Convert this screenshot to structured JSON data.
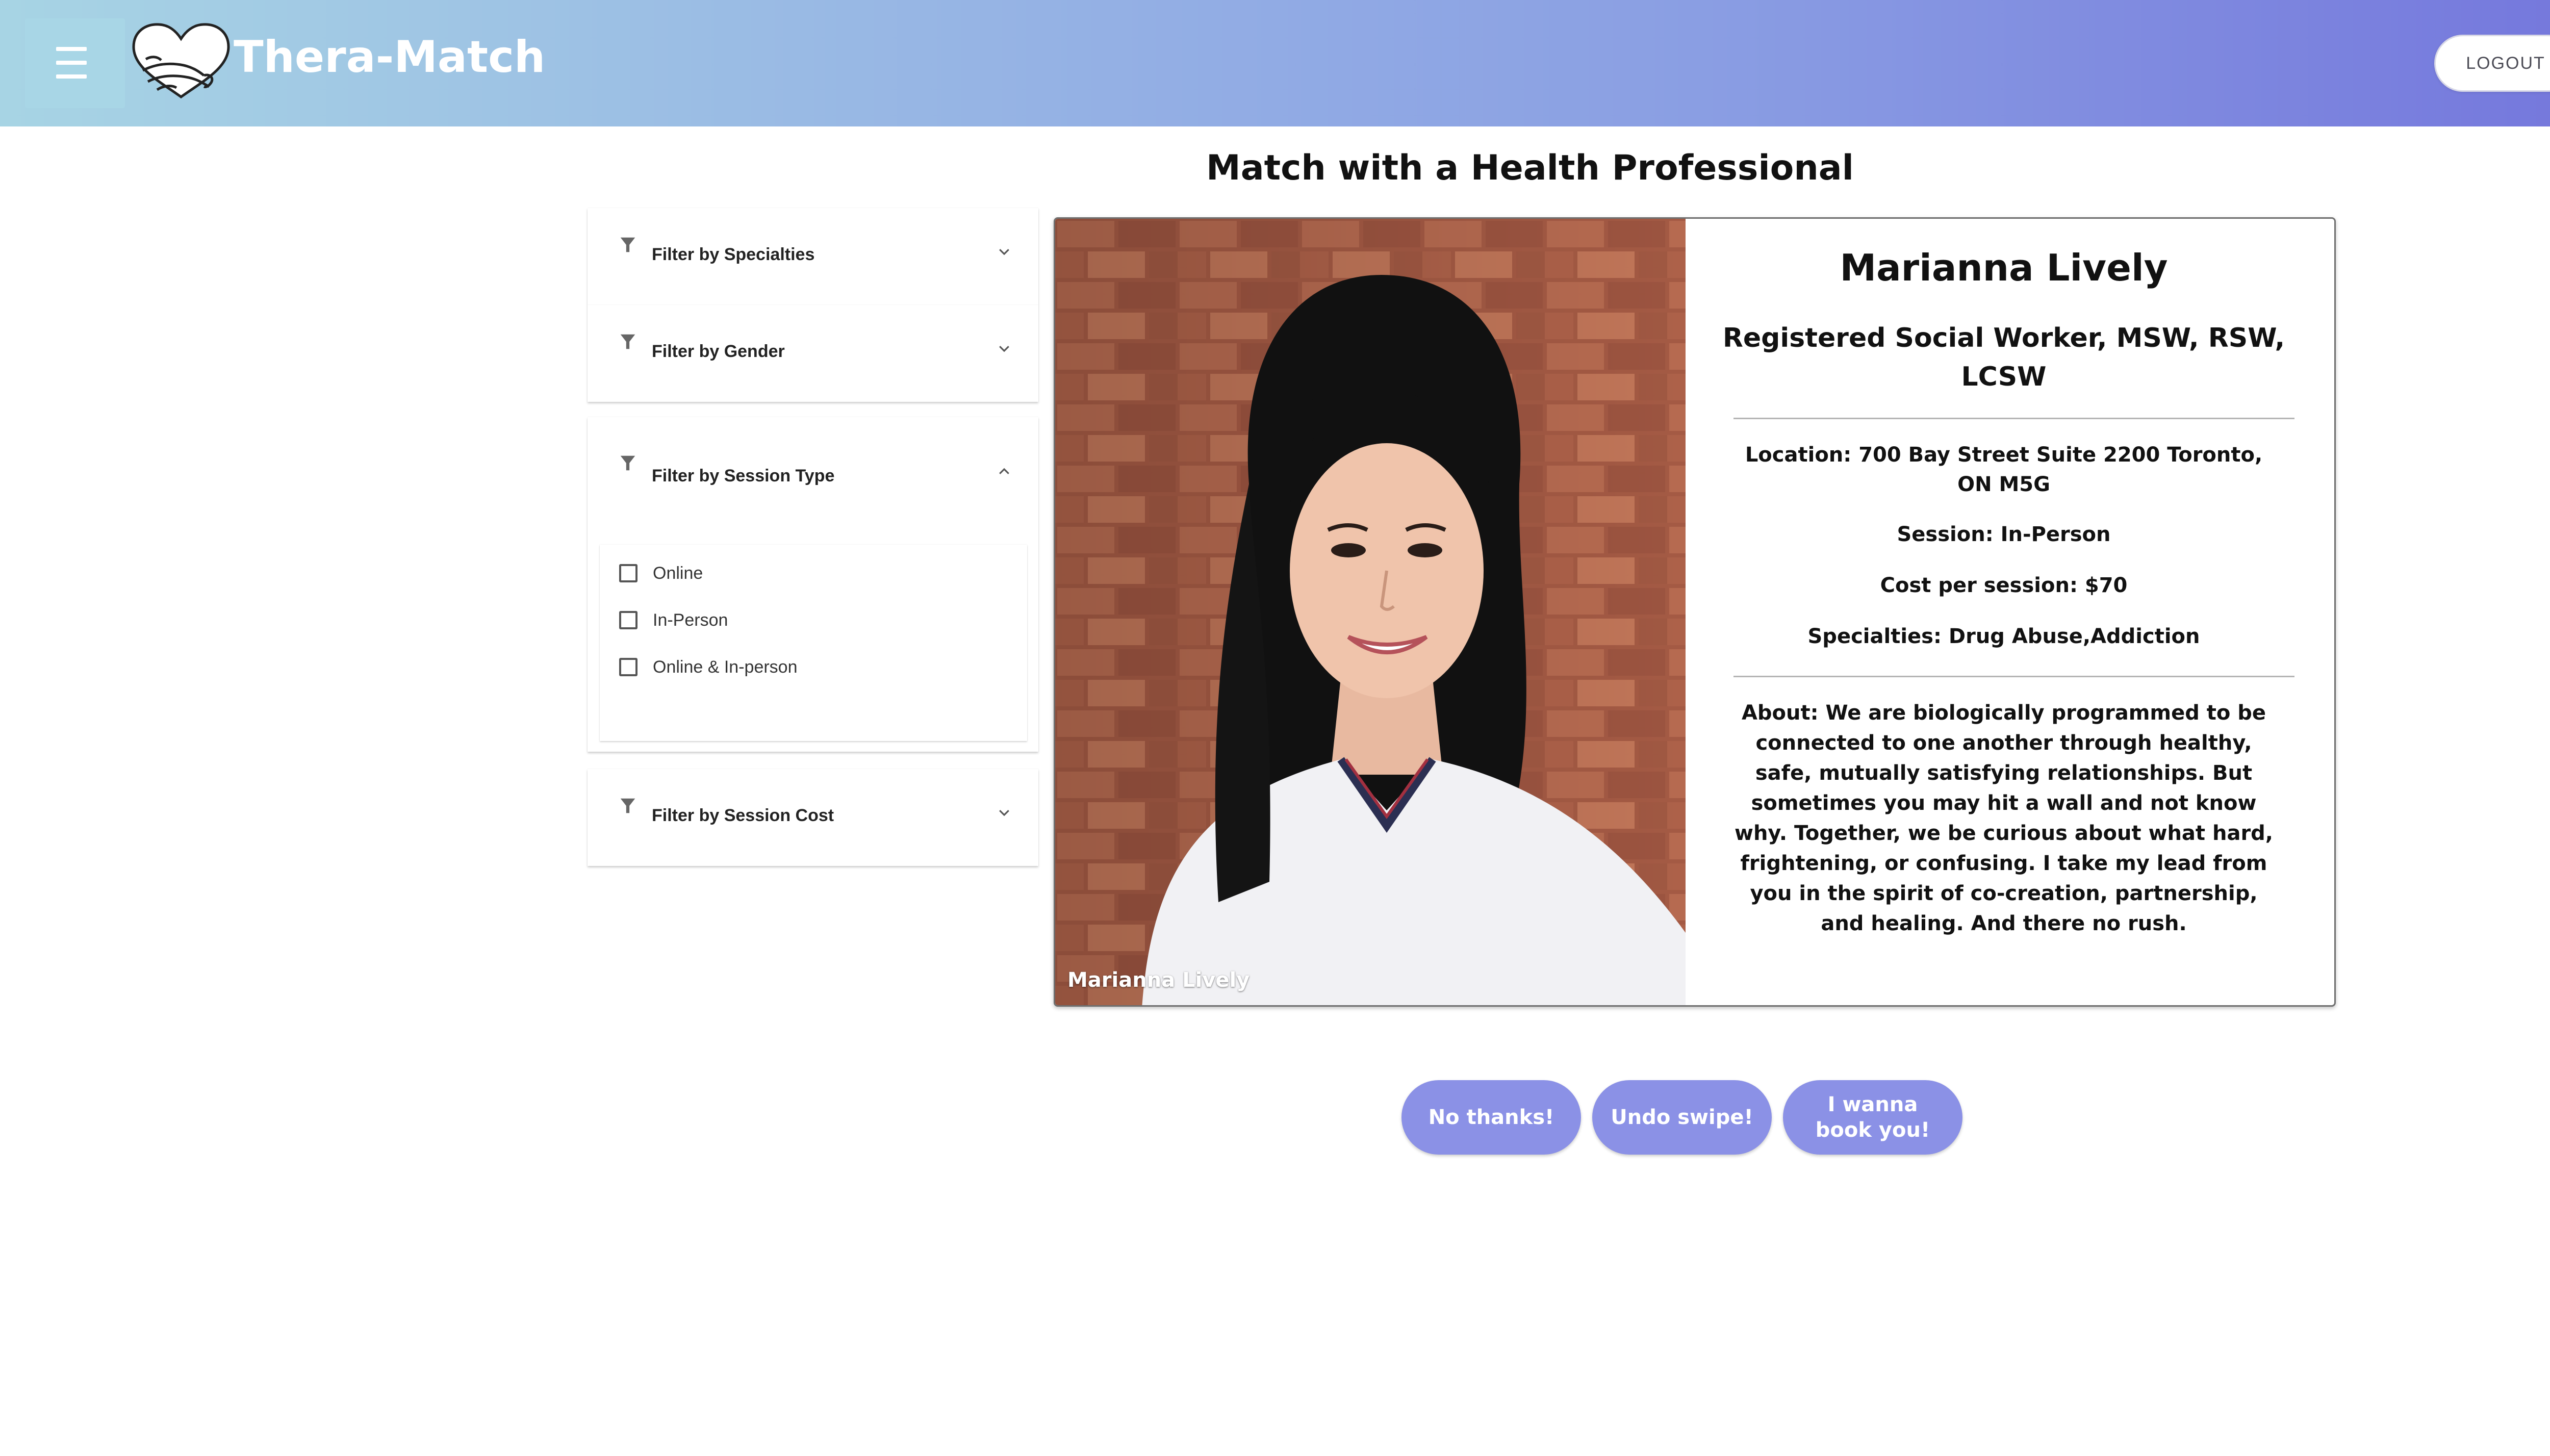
{
  "header": {
    "app_title": "Thera-Match",
    "logout_label": "LOGOUT",
    "gradient_colors": [
      "#a7d4e4",
      "#97b6e4",
      "#8a9ee3",
      "#7476dc"
    ]
  },
  "page_title": "Match with a Health Professional",
  "filters": [
    {
      "label": "Filter by Specialties",
      "expanded": false
    },
    {
      "label": "Filter by Gender",
      "expanded": false
    },
    {
      "label": "Filter by Session Type",
      "expanded": true,
      "options": [
        {
          "label": "Online",
          "checked": false
        },
        {
          "label": "In-Person",
          "checked": false
        },
        {
          "label": "Online & In-person",
          "checked": false
        }
      ]
    },
    {
      "label": "Filter by Session Cost",
      "expanded": false
    }
  ],
  "card": {
    "photo_caption": "Marianna Lively",
    "name": "Marianna Lively",
    "credentials": "Registered Social Worker, MSW, RSW, LCSW",
    "location": "Location: 700 Bay Street Suite 2200 Toronto, ON M5G",
    "session": "Session: In-Person",
    "cost": "Cost per session: $70",
    "specialties": "Specialties: Drug Abuse,Addiction",
    "about": "About: We are biologically programmed to be connected to one another through healthy, safe, mutually satisfying relationships. But sometimes you may hit a wall and not know why. Together, we be curious about what hard, frightening, or confusing. I take my lead from you in the spirit of co-creation, partnership, and healing. And there no rush."
  },
  "actions": {
    "no_thanks": "No thanks!",
    "undo": "Undo swipe!",
    "book": "I wanna book you!",
    "button_color": "#8b91e6"
  },
  "icons": {
    "menu": "hamburger-menu-icon",
    "logo": "heart-hug-logo-icon",
    "filter": "funnel-filter-icon",
    "expand": "chevron-down-icon",
    "collapse": "chevron-up-icon"
  }
}
